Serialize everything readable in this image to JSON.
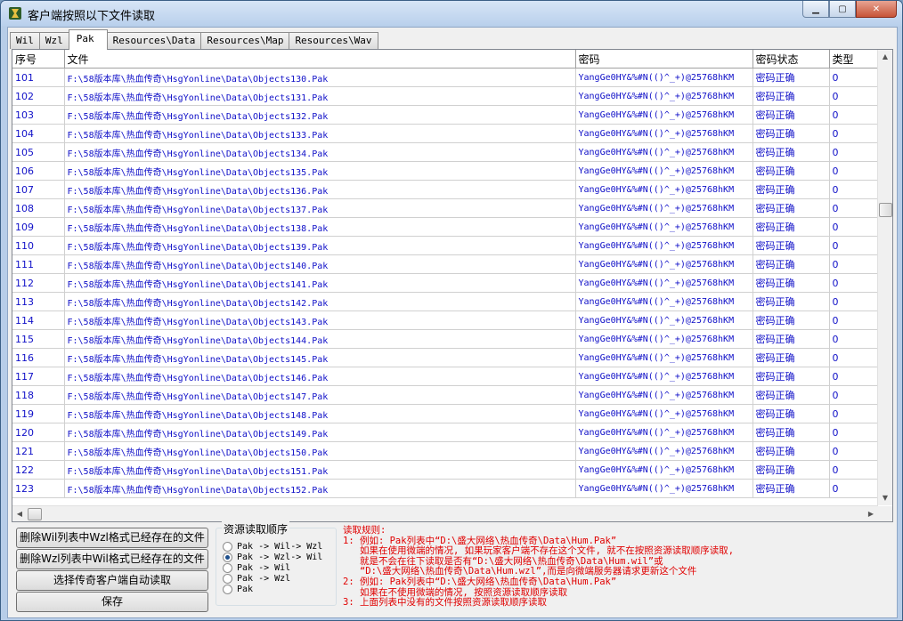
{
  "window": {
    "title": "客户端按照以下文件读取",
    "min_glyph": "▁",
    "max_glyph": "▢",
    "close_glyph": "✕"
  },
  "tabs": [
    {
      "label": "Wil",
      "active": false
    },
    {
      "label": "Wzl",
      "active": false
    },
    {
      "label": "Pak",
      "active": true
    },
    {
      "label": "Resources\\Data",
      "active": false
    },
    {
      "label": "Resources\\Map",
      "active": false
    },
    {
      "label": "Resources\\Wav",
      "active": false
    }
  ],
  "table": {
    "columns": [
      "序号",
      "文件",
      "密码",
      "密码状态",
      "类型"
    ],
    "rows": [
      {
        "id": "101",
        "file": "F:\\58版本库\\热血传奇\\HsgYonline\\Data\\Objects130.Pak",
        "password": "YangGe0HY&%#N(()^_+)@25768hKM",
        "status": "密码正确",
        "type": "0"
      },
      {
        "id": "102",
        "file": "F:\\58版本库\\热血传奇\\HsgYonline\\Data\\Objects131.Pak",
        "password": "YangGe0HY&%#N(()^_+)@25768hKM",
        "status": "密码正确",
        "type": "0"
      },
      {
        "id": "103",
        "file": "F:\\58版本库\\热血传奇\\HsgYonline\\Data\\Objects132.Pak",
        "password": "YangGe0HY&%#N(()^_+)@25768hKM",
        "status": "密码正确",
        "type": "0"
      },
      {
        "id": "104",
        "file": "F:\\58版本库\\热血传奇\\HsgYonline\\Data\\Objects133.Pak",
        "password": "YangGe0HY&%#N(()^_+)@25768hKM",
        "status": "密码正确",
        "type": "0"
      },
      {
        "id": "105",
        "file": "F:\\58版本库\\热血传奇\\HsgYonline\\Data\\Objects134.Pak",
        "password": "YangGe0HY&%#N(()^_+)@25768hKM",
        "status": "密码正确",
        "type": "0"
      },
      {
        "id": "106",
        "file": "F:\\58版本库\\热血传奇\\HsgYonline\\Data\\Objects135.Pak",
        "password": "YangGe0HY&%#N(()^_+)@25768hKM",
        "status": "密码正确",
        "type": "0"
      },
      {
        "id": "107",
        "file": "F:\\58版本库\\热血传奇\\HsgYonline\\Data\\Objects136.Pak",
        "password": "YangGe0HY&%#N(()^_+)@25768hKM",
        "status": "密码正确",
        "type": "0"
      },
      {
        "id": "108",
        "file": "F:\\58版本库\\热血传奇\\HsgYonline\\Data\\Objects137.Pak",
        "password": "YangGe0HY&%#N(()^_+)@25768hKM",
        "status": "密码正确",
        "type": "0"
      },
      {
        "id": "109",
        "file": "F:\\58版本库\\热血传奇\\HsgYonline\\Data\\Objects138.Pak",
        "password": "YangGe0HY&%#N(()^_+)@25768hKM",
        "status": "密码正确",
        "type": "0"
      },
      {
        "id": "110",
        "file": "F:\\58版本库\\热血传奇\\HsgYonline\\Data\\Objects139.Pak",
        "password": "YangGe0HY&%#N(()^_+)@25768hKM",
        "status": "密码正确",
        "type": "0"
      },
      {
        "id": "111",
        "file": "F:\\58版本库\\热血传奇\\HsgYonline\\Data\\Objects140.Pak",
        "password": "YangGe0HY&%#N(()^_+)@25768hKM",
        "status": "密码正确",
        "type": "0"
      },
      {
        "id": "112",
        "file": "F:\\58版本库\\热血传奇\\HsgYonline\\Data\\Objects141.Pak",
        "password": "YangGe0HY&%#N(()^_+)@25768hKM",
        "status": "密码正确",
        "type": "0"
      },
      {
        "id": "113",
        "file": "F:\\58版本库\\热血传奇\\HsgYonline\\Data\\Objects142.Pak",
        "password": "YangGe0HY&%#N(()^_+)@25768hKM",
        "status": "密码正确",
        "type": "0"
      },
      {
        "id": "114",
        "file": "F:\\58版本库\\热血传奇\\HsgYonline\\Data\\Objects143.Pak",
        "password": "YangGe0HY&%#N(()^_+)@25768hKM",
        "status": "密码正确",
        "type": "0"
      },
      {
        "id": "115",
        "file": "F:\\58版本库\\热血传奇\\HsgYonline\\Data\\Objects144.Pak",
        "password": "YangGe0HY&%#N(()^_+)@25768hKM",
        "status": "密码正确",
        "type": "0"
      },
      {
        "id": "116",
        "file": "F:\\58版本库\\热血传奇\\HsgYonline\\Data\\Objects145.Pak",
        "password": "YangGe0HY&%#N(()^_+)@25768hKM",
        "status": "密码正确",
        "type": "0"
      },
      {
        "id": "117",
        "file": "F:\\58版本库\\热血传奇\\HsgYonline\\Data\\Objects146.Pak",
        "password": "YangGe0HY&%#N(()^_+)@25768hKM",
        "status": "密码正确",
        "type": "0"
      },
      {
        "id": "118",
        "file": "F:\\58版本库\\热血传奇\\HsgYonline\\Data\\Objects147.Pak",
        "password": "YangGe0HY&%#N(()^_+)@25768hKM",
        "status": "密码正确",
        "type": "0"
      },
      {
        "id": "119",
        "file": "F:\\58版本库\\热血传奇\\HsgYonline\\Data\\Objects148.Pak",
        "password": "YangGe0HY&%#N(()^_+)@25768hKM",
        "status": "密码正确",
        "type": "0"
      },
      {
        "id": "120",
        "file": "F:\\58版本库\\热血传奇\\HsgYonline\\Data\\Objects149.Pak",
        "password": "YangGe0HY&%#N(()^_+)@25768hKM",
        "status": "密码正确",
        "type": "0"
      },
      {
        "id": "121",
        "file": "F:\\58版本库\\热血传奇\\HsgYonline\\Data\\Objects150.Pak",
        "password": "YangGe0HY&%#N(()^_+)@25768hKM",
        "status": "密码正确",
        "type": "0"
      },
      {
        "id": "122",
        "file": "F:\\58版本库\\热血传奇\\HsgYonline\\Data\\Objects151.Pak",
        "password": "YangGe0HY&%#N(()^_+)@25768hKM",
        "status": "密码正确",
        "type": "0"
      },
      {
        "id": "123",
        "file": "F:\\58版本库\\热血传奇\\HsgYonline\\Data\\Objects152.Pak",
        "password": "YangGe0HY&%#N(()^_+)@25768hKM",
        "status": "密码正确",
        "type": "0"
      }
    ]
  },
  "buttons": {
    "delete_wil": "删除Wil列表中Wzl格式已经存在的文件",
    "delete_wzl": "删除Wzl列表中Wil格式已经存在的文件",
    "select_client": "选择传奇客户端自动读取",
    "save": "保存"
  },
  "read_order": {
    "label": "资源读取顺序",
    "options": [
      {
        "label": "Pak -> Wil-> Wzl",
        "selected": false
      },
      {
        "label": "Pak -> Wzl-> Wil",
        "selected": true
      },
      {
        "label": "Pak -> Wil",
        "selected": false
      },
      {
        "label": "Pak -> Wzl",
        "selected": false
      },
      {
        "label": "Pak",
        "selected": false
      }
    ]
  },
  "rules": [
    "读取规则:",
    "1: 例如: Pak列表中“D:\\盛大网络\\热血传奇\\Data\\Hum.Pak”",
    "   如果在使用微端的情况, 如果玩家客户端不存在这个文件, 就不在按照资源读取顺序读取,",
    "   就是不会在往下读取是否有“D:\\盛大网络\\热血传奇\\Data\\Hum.wil”或",
    "   “D:\\盛大网络\\热血传奇\\Data\\Hum.wzl”,而是向微端服务器请求更新这个文件",
    "2: 例如: Pak列表中“D:\\盛大网络\\热血传奇\\Data\\Hum.Pak”",
    "   如果在不使用微端的情况, 按照资源读取顺序读取",
    "3: 上面列表中没有的文件按照资源读取顺序读取"
  ],
  "colors": {
    "cell_text": "#1010c8",
    "rules_text": "#e00000",
    "radio_dot": "#1c4e8c"
  }
}
